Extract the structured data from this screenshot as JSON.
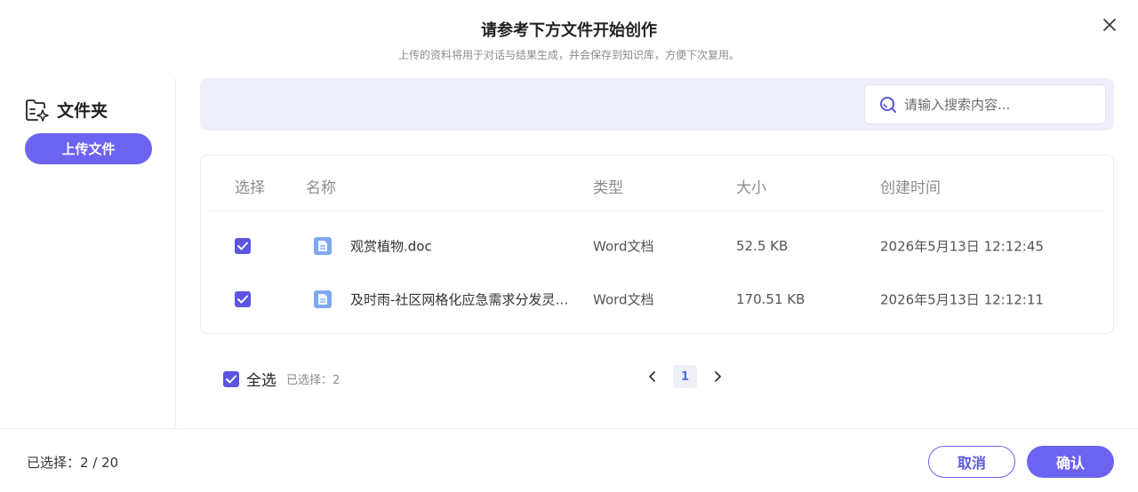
{
  "dialog": {
    "title": "请参考下方文件开始创作",
    "subtitle": "上传的资料将用于对话与结果生成，并会保存到知识库，方便下次复用。"
  },
  "sidebar": {
    "folder_label": "文件夹",
    "upload_label": "上传文件"
  },
  "search": {
    "placeholder": "请输入搜索内容..."
  },
  "table": {
    "headers": {
      "select": "选择",
      "name": "名称",
      "type": "类型",
      "size": "大小",
      "created": "创建时间"
    },
    "rows": [
      {
        "checked": true,
        "name": "观赏植物.doc",
        "type": "Word文档",
        "size": "52.5 KB",
        "created": "2026年5月13日 12:12:45"
      },
      {
        "checked": true,
        "name": "及时雨-社区网格化应急需求分发灵…",
        "type": "Word文档",
        "size": "170.51 KB",
        "created": "2026年5月13日 12:12:11"
      }
    ]
  },
  "selection": {
    "select_all_label": "全选",
    "selected_text": "已选择：2"
  },
  "pagination": {
    "current_page": "1"
  },
  "footer": {
    "selected_summary": "已选择：2 / 20",
    "cancel_label": "取消",
    "confirm_label": "确认"
  },
  "colors": {
    "accent": "#6c63f0",
    "checkbox": "#5b55e0",
    "search_bg": "#efeefb"
  },
  "icons": {
    "close": "close-icon",
    "folder": "folder-sparkle-icon",
    "search": "search-icon",
    "file": "word-file-icon",
    "check": "check-icon",
    "prev": "chevron-left-icon",
    "next": "chevron-right-icon"
  }
}
